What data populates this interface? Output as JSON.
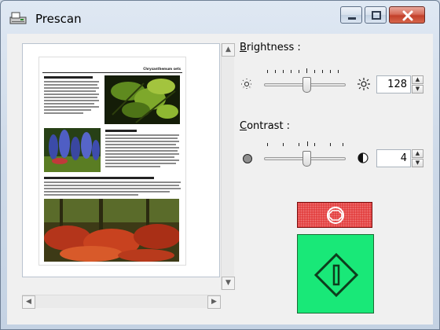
{
  "window": {
    "title": "Prescan",
    "controls": [
      "minimize-icon",
      "maximize-icon",
      "close-icon"
    ]
  },
  "preview": {
    "document": {
      "header": "Chrysanthemum sets",
      "sections": [
        {
          "heading": "Green chrysanthemum leaves",
          "photo": "leaves"
        },
        {
          "heading": "Bluebells",
          "photo": "blue-flowers"
        },
        {
          "heading": "Inspiration: spider lilies in autumn",
          "photo": "red-flowers"
        }
      ]
    }
  },
  "brightness": {
    "label_prefix": "",
    "label_mnemonic": "B",
    "label_rest": "rightness :",
    "value": "128",
    "slider_fraction": 0.5,
    "low_icon": "dim-sun-icon",
    "high_icon": "bright-sun-icon"
  },
  "contrast": {
    "label_mnemonic": "C",
    "label_rest": "ontrast :",
    "value": "4",
    "slider_fraction": 0.5,
    "low_icon": "low-contrast-icon",
    "high_icon": "high-contrast-icon"
  },
  "buttons": {
    "stop_icon": "stop-icon",
    "start_icon": "start-icon"
  }
}
